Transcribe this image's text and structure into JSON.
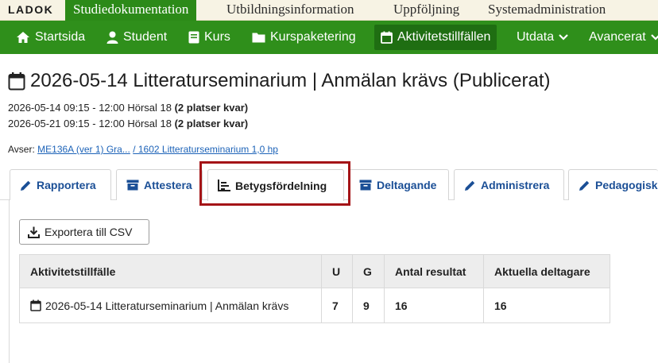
{
  "top": {
    "logo": "LADOK",
    "tabs": [
      "Studiedokumentation",
      "Utbildningsinformation",
      "Uppföljning",
      "Systemadministration"
    ]
  },
  "nav": {
    "items": [
      {
        "label": "Startsida",
        "icon": "home-icon"
      },
      {
        "label": "Student",
        "icon": "user-icon"
      },
      {
        "label": "Kurs",
        "icon": "book-icon"
      },
      {
        "label": "Kurspaketering",
        "icon": "folder-icon"
      },
      {
        "label": "Aktivitetstillfällen",
        "icon": "calendar-icon",
        "active": true
      },
      {
        "label": "Utdata",
        "icon": "chevron-down-icon"
      },
      {
        "label": "Avancerat",
        "icon": "chevron-down-icon"
      }
    ]
  },
  "page": {
    "title": "2026-05-14 Litteraturseminarium | Anmälan krävs (Publicerat)",
    "sessions": [
      {
        "text": "2026-05-14 09:15 - 12:00 Hörsal 18 ",
        "bold": "(2 platser kvar)"
      },
      {
        "text": "2026-05-21 09:15 - 12:00 Hörsal 18 ",
        "bold": "(2 platser kvar)"
      }
    ],
    "avser_label": "Avser:",
    "avser_link1": "ME136A (ver 1) Gra...",
    "avser_link2": "/ 1602 Litteraturseminarium 1,0 hp"
  },
  "tabs": [
    {
      "label": "Rapportera",
      "icon": "pencil-icon"
    },
    {
      "label": "Attestera",
      "icon": "archive-icon"
    },
    {
      "label": "Betygsfördelning",
      "icon": "bar-chart-icon",
      "active": true
    },
    {
      "label": "Deltagande",
      "icon": "archive-icon"
    },
    {
      "label": "Administrera",
      "icon": "pencil-icon"
    },
    {
      "label": "Pedagogisk",
      "icon": "pencil-icon"
    }
  ],
  "export": {
    "label": "Exportera till CSV",
    "icon": "download-icon"
  },
  "table": {
    "headers": [
      "Aktivitetstillfälle",
      "U",
      "G",
      "Antal resultat",
      "Aktuella deltagare"
    ],
    "rows": [
      [
        "2026-05-14 Litteraturseminarium | Anmälan krävs",
        "7",
        "9",
        "16",
        "16"
      ]
    ]
  },
  "colors": {
    "nav_green": "#2f8f1b",
    "active_nav": "#1f6e12",
    "link_blue": "#1d63b8",
    "highlight_red": "#a41417"
  }
}
